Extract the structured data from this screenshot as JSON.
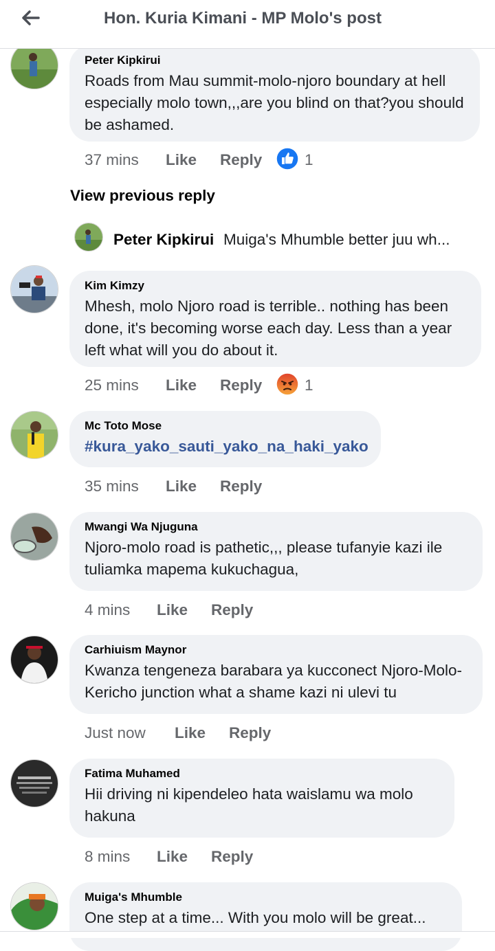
{
  "header": {
    "title": "Hon. Kuria Kimani  - MP Molo's post",
    "back_icon": "arrow-left-icon"
  },
  "thread": {
    "view_previous": "View previous reply",
    "collapsed_reply": {
      "name": "Peter Kipkirui",
      "text": "Muiga's Mhumble better juu wh..."
    }
  },
  "comments": [
    {
      "name": "Peter Kipkirui",
      "text": "Roads from Mau summit-molo-njoro  boundary at hell especially molo town,,,are you blind on that?you should be ashamed.",
      "time": "37 mins",
      "like": "Like",
      "reply": "Reply",
      "reaction": "like",
      "reaction_count": "1"
    },
    {
      "name": "Kim Kimzy",
      "text": "Mhesh, molo Njoro road is terrible.. nothing has been done, it's becoming worse each day. Less than a year left what will you do about it.",
      "time": "25 mins",
      "like": "Like",
      "reply": "Reply",
      "reaction": "angry",
      "reaction_count": "1"
    },
    {
      "name": "Mc Toto Mose",
      "text": "#kura_yako_sauti_yako_na_haki_yako",
      "time": "35 mins",
      "like": "Like",
      "reply": "Reply"
    },
    {
      "name": "Mwangi Wa Njuguna",
      "text": "Njoro-molo road is pathetic,,, please tufanyie kazi ile tuliamka mapema kukuchagua,",
      "time": "4 mins",
      "like": "Like",
      "reply": "Reply"
    },
    {
      "name": "Carhiuism Maynor",
      "text": "Kwanza tengeneza barabara ya kucconect Njoro-Molo- Kericho junction what a shame kazi ni ulevi tu",
      "time": "Just now",
      "like": "Like",
      "reply": "Reply"
    },
    {
      "name": "Fatima Muhamed",
      "text": "Hii driving ni kipendeleo hata waislamu wa molo hakuna",
      "time": "8 mins",
      "like": "Like",
      "reply": "Reply"
    },
    {
      "name": "Muiga's Mhumble",
      "text": "One step at a time... With you molo will be great...",
      "time": "",
      "like": "",
      "reply": ""
    }
  ],
  "colors": {
    "bubble": "#f0f2f5",
    "link": "#385898",
    "meta": "#65676b",
    "like_blue": "#1877f2",
    "angry_orange": "#f0742c"
  }
}
